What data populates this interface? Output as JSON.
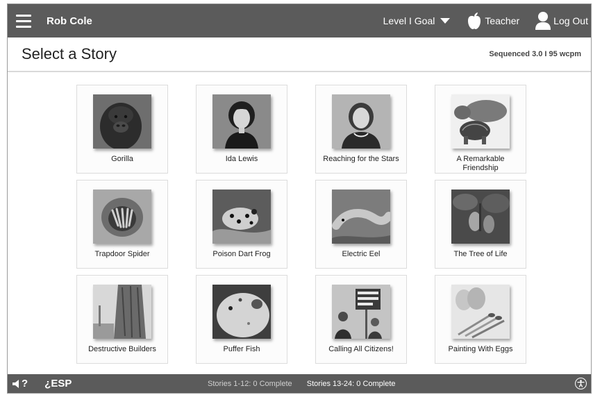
{
  "topbar": {
    "user_name": "Rob Cole",
    "level_goal": "Level I Goal",
    "teacher_label": "Teacher",
    "logout_label": "Log Out"
  },
  "header": {
    "title": "Select a Story",
    "sequence_info": "Sequenced 3.0 I 95 wcpm"
  },
  "stories": [
    {
      "title": "Gorilla",
      "icon": "gorilla-image"
    },
    {
      "title": "Ida Lewis",
      "icon": "portrait-image"
    },
    {
      "title": "Reaching for the Stars",
      "icon": "astronaut-image"
    },
    {
      "title": "A Remarkable Friendship",
      "icon": "hippo-tortoise-image"
    },
    {
      "title": "Trapdoor Spider",
      "icon": "spider-image"
    },
    {
      "title": "Poison Dart Frog",
      "icon": "frog-image"
    },
    {
      "title": "Electric Eel",
      "icon": "eel-image"
    },
    {
      "title": "The Tree of Life",
      "icon": "tree-fruit-image"
    },
    {
      "title": "Destructive Builders",
      "icon": "tree-bark-image"
    },
    {
      "title": "Puffer Fish",
      "icon": "puffer-fish-image"
    },
    {
      "title": "Calling All Citizens!",
      "icon": "citizens-image"
    },
    {
      "title": "Painting With Eggs",
      "icon": "eggs-image"
    }
  ],
  "footer": {
    "audio_help_label": "?",
    "esp_label": "¿ESP",
    "progress_1": "Stories 1-12: 0 Complete",
    "progress_2": "Stories 13-24: 0 Complete"
  },
  "colors": {
    "bar_bg": "#5b5b5b",
    "card_border": "#dcdcdc"
  }
}
